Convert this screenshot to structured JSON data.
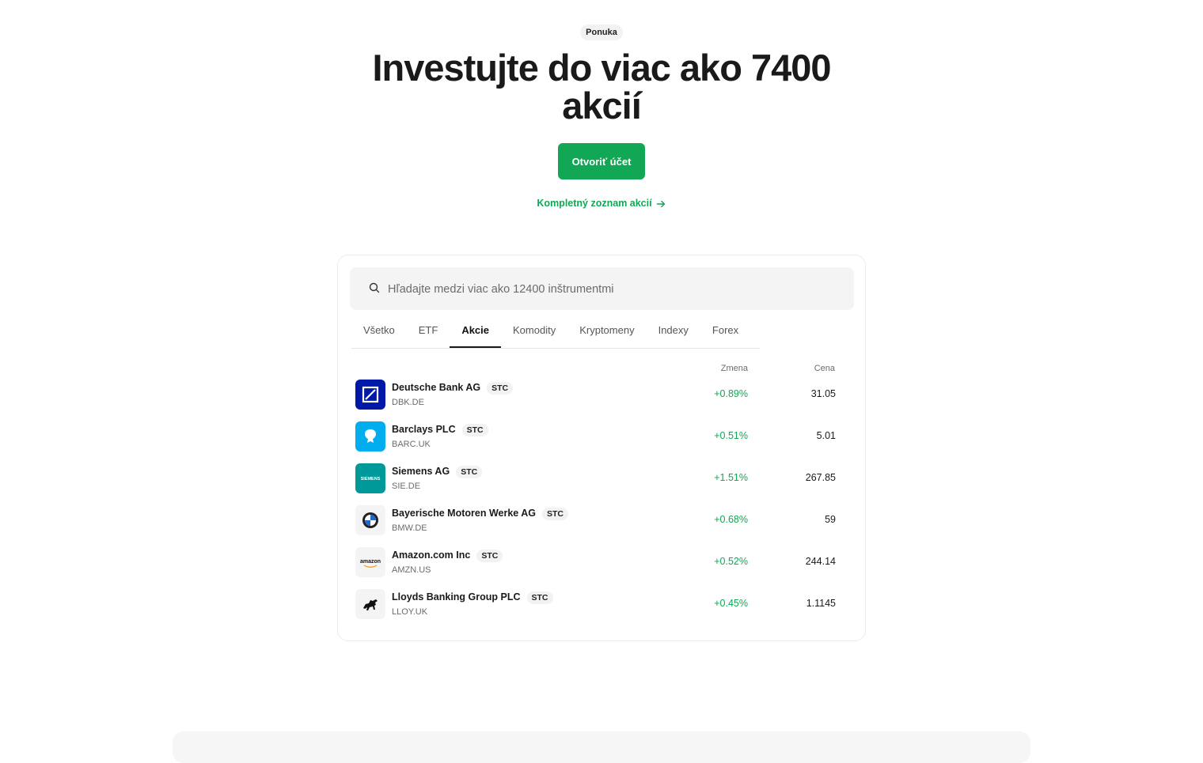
{
  "hero": {
    "pill": "Ponuka",
    "headline": "Investujte do viac ako 7400 akcií",
    "cta": "Otvoriť účet",
    "list_link": "Kompletný zoznam akcií"
  },
  "search": {
    "placeholder": "Hľadajte medzi viac ako 12400 inštrumentmi",
    "icon": "search-icon"
  },
  "tabs": [
    {
      "label": "Všetko",
      "active": false
    },
    {
      "label": "ETF",
      "active": false
    },
    {
      "label": "Akcie",
      "active": true
    },
    {
      "label": "Komodity",
      "active": false
    },
    {
      "label": "Kryptomeny",
      "active": false
    },
    {
      "label": "Indexy",
      "active": false
    },
    {
      "label": "Forex",
      "active": false
    }
  ],
  "columns": {
    "change": "Zmena",
    "price": "Cena"
  },
  "instruments": [
    {
      "name": "Deutsche Bank AG",
      "badge": "STC",
      "ticker": "DBK.DE",
      "change": "+0.89%",
      "price": "31.05",
      "logo": "deutsche-bank-logo"
    },
    {
      "name": "Barclays PLC",
      "badge": "STC",
      "ticker": "BARC.UK",
      "change": "+0.51%",
      "price": "5.01",
      "logo": "barclays-logo"
    },
    {
      "name": "Siemens AG",
      "badge": "STC",
      "ticker": "SIE.DE",
      "change": "+1.51%",
      "price": "267.85",
      "logo": "siemens-logo",
      "logo_text": "SIEMENS"
    },
    {
      "name": "Bayerische Motoren Werke AG",
      "badge": "STC",
      "ticker": "BMW.DE",
      "change": "+0.68%",
      "price": "59",
      "logo": "bmw-logo"
    },
    {
      "name": "Amazon.com Inc",
      "badge": "STC",
      "ticker": "AMZN.US",
      "change": "+0.52%",
      "price": "244.14",
      "logo": "amazon-logo",
      "logo_text": "amazon"
    },
    {
      "name": "Lloyds Banking Group PLC",
      "badge": "STC",
      "ticker": "LLOY.UK",
      "change": "+0.45%",
      "price": "1.1145",
      "logo": "lloyds-logo"
    }
  ],
  "colors": {
    "accent": "#11a754",
    "text": "#1a1a1a",
    "muted": "#6b6b6b"
  }
}
